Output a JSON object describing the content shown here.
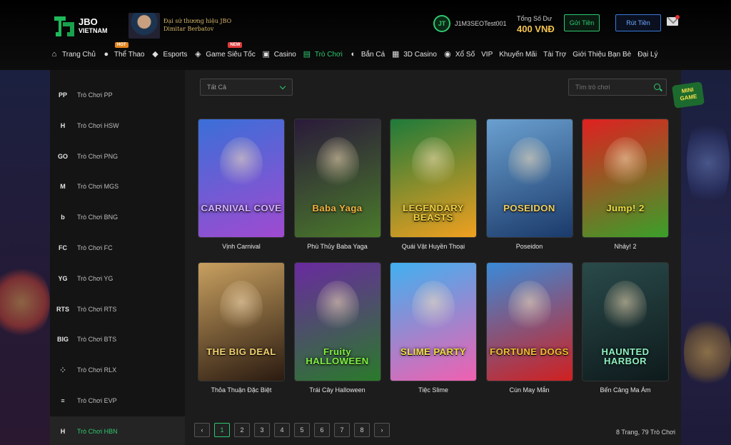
{
  "header": {
    "logo_text": "JBO",
    "logo_sub": "VIETNAM",
    "ambassador_line1": "Đại sứ thương hiệu JBO",
    "ambassador_line2": "Dimitar Berbatov",
    "username": "J1M3SEOTest001",
    "balance_label": "Tổng Số Dư",
    "balance_value": "400 VNĐ",
    "deposit_label": "Gửi Tiền",
    "withdraw_label": "Rút Tiền"
  },
  "nav": {
    "items": [
      {
        "label": "Trang Chủ",
        "icon": "home-icon"
      },
      {
        "label": "Thể Thao",
        "icon": "soccer-ball-icon",
        "badge": "HOT"
      },
      {
        "label": "Esports",
        "icon": "gamepad-icon"
      },
      {
        "label": "Game Siêu Tốc",
        "icon": "controller-icon",
        "badge": "NEW"
      },
      {
        "label": "Casino",
        "icon": "cards-icon"
      },
      {
        "label": "Trò Chơi",
        "icon": "slot-machine-icon",
        "active": true
      },
      {
        "label": "Bắn Cá",
        "icon": "fish-icon"
      },
      {
        "label": "3D Casino",
        "icon": "cube-icon"
      },
      {
        "label": "Xổ Số",
        "icon": "lottery-ball-icon"
      },
      {
        "label": "VIP"
      },
      {
        "label": "Khuyến Mãi"
      },
      {
        "label": "Tài Trợ"
      },
      {
        "label": "Giới Thiệu Bạn Bè"
      },
      {
        "label": "Đại Lý"
      }
    ]
  },
  "sidebar": {
    "items": [
      {
        "label": "Trò Chơi PP",
        "icon_text": "PP"
      },
      {
        "label": "Trò Chơi HSW",
        "icon_text": "H"
      },
      {
        "label": "Trò Chơi PNG",
        "icon_text": "GO"
      },
      {
        "label": "Trò Chơi MGS",
        "icon_text": "M"
      },
      {
        "label": "Trò Chơi BNG",
        "icon_text": "b"
      },
      {
        "label": "Trò Chơi FC",
        "icon_text": "FC"
      },
      {
        "label": "Trò Chơi YG",
        "icon_text": "YG"
      },
      {
        "label": "Trò Chơi RTS",
        "icon_text": "RTS"
      },
      {
        "label": "Trò Chơi BTS",
        "icon_text": "BIG"
      },
      {
        "label": "Trò Chơi RLX",
        "icon_text": "⁘"
      },
      {
        "label": "Trò Chơi EVP",
        "icon_text": "≡"
      },
      {
        "label": "Trò Chơi HBN",
        "icon_text": "H",
        "active": true
      }
    ]
  },
  "filter": {
    "selected": "Tất Cả"
  },
  "search": {
    "placeholder": "Tìm trò chơi"
  },
  "minigame": {
    "line1": "MINI",
    "line2": "GAME"
  },
  "games": [
    {
      "name": "Vịnh Carnival",
      "art_title": "CARNIVAL COVE",
      "bg": [
        "#3a6fd8",
        "#a04ad0"
      ],
      "title_color": "#d6b4ff"
    },
    {
      "name": "Phù Thủy Baba Yaga",
      "art_title": "Baba Yaga",
      "bg": [
        "#2a1a3a",
        "#4a7a2a"
      ],
      "title_color": "#f2b640"
    },
    {
      "name": "Quái Vật Huyền Thoại",
      "art_title": "LEGENDARY BEASTS",
      "bg": [
        "#1e7a3a",
        "#f0a020"
      ],
      "title_color": "#f0d040"
    },
    {
      "name": "Poseidon",
      "art_title": "POSEIDON",
      "bg": [
        "#6aa0d0",
        "#1a3a6a"
      ],
      "title_color": "#f0d060"
    },
    {
      "name": "Nhảy! 2",
      "art_title": "Jump! 2",
      "bg": [
        "#e02020",
        "#3aa02a"
      ],
      "title_color": "#f0e040"
    },
    {
      "name": "Thỏa Thuận Đặc Biệt",
      "art_title": "THE BIG DEAL",
      "bg": [
        "#c8a060",
        "#2a1a10"
      ],
      "title_color": "#f0d070"
    },
    {
      "name": "Trái Cây Halloween",
      "art_title": "Fruity HALLOWEEN",
      "bg": [
        "#6a2aa0",
        "#2a7a2a"
      ],
      "title_color": "#80f040"
    },
    {
      "name": "Tiệc Slime",
      "art_title": "SLIME PARTY",
      "bg": [
        "#40b0f0",
        "#f060b0"
      ],
      "title_color": "#f0e040"
    },
    {
      "name": "Cún May Mắn",
      "art_title": "FORTUNE DOGS",
      "bg": [
        "#3a8ad8",
        "#d02020"
      ],
      "title_color": "#f0c030"
    },
    {
      "name": "Bến Cảng Ma Ám",
      "art_title": "HAUNTED HARBOR",
      "bg": [
        "#2a4a4a",
        "#0e1a1c"
      ],
      "title_color": "#8ef0c0"
    }
  ],
  "pagination": {
    "pages": [
      "1",
      "2",
      "3",
      "4",
      "5",
      "6",
      "7",
      "8"
    ],
    "current": "1",
    "prev_label": "‹",
    "next_label": "›",
    "info": "8 Trang,  79 Trò Chơi"
  },
  "colors": {
    "accent": "#2ec86e",
    "balance": "#f5c44e",
    "withdraw": "#3a7ad8"
  }
}
